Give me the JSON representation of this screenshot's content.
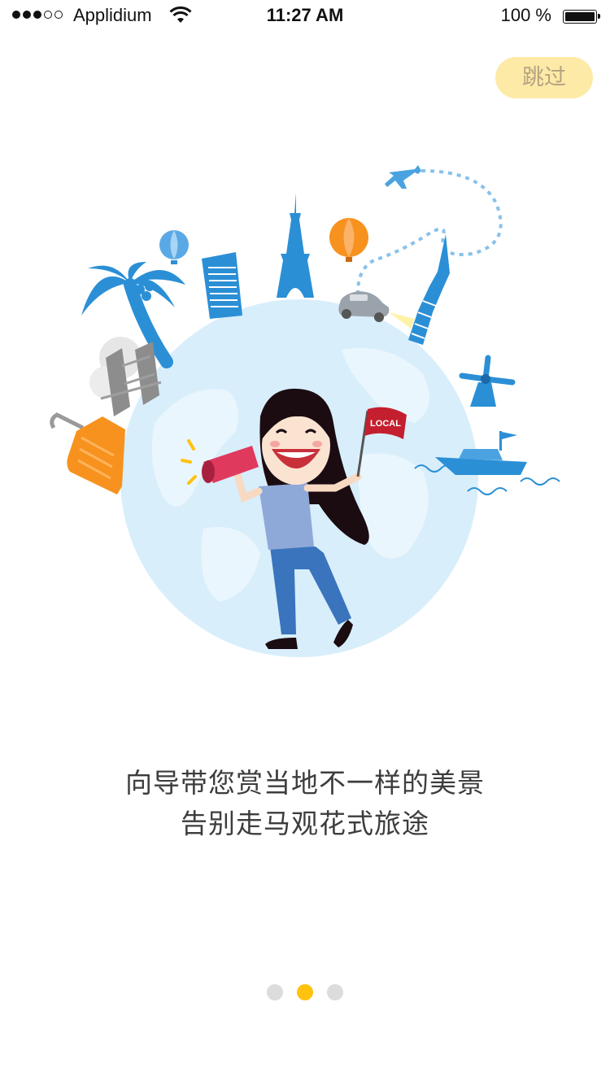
{
  "status_bar": {
    "carrier": "Applidium",
    "time": "11:27 AM",
    "battery_percent_label": "100 %",
    "battery_level": 1.0,
    "signal_bars_filled": 3,
    "signal_bars_total": 5
  },
  "skip_button": {
    "label": "跳过"
  },
  "illustration": {
    "flag_text": "LOCAL"
  },
  "caption": {
    "line1": "向导带您赏当地不一样的美景",
    "line2": "告别走马观花式旅途"
  },
  "pager": {
    "count": 3,
    "active_index": 1,
    "active_color": "#ffc20e",
    "inactive_color": "#dcdcdc"
  },
  "colors": {
    "skip_bg": "#fdeaa6",
    "skip_text": "#b3a382",
    "globe": "#d8eefb",
    "accent_blue": "#2b8fd6",
    "orange": "#f7921e"
  }
}
